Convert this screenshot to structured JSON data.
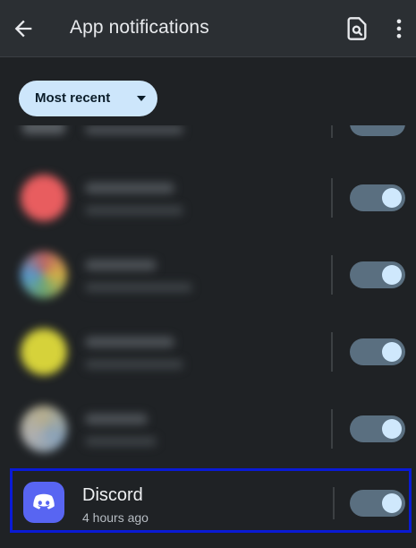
{
  "header": {
    "title": "App notifications",
    "icons": {
      "back": "arrow-back-icon",
      "search": "search-document-icon",
      "more": "more-vert-icon"
    }
  },
  "filter": {
    "selected": "Most recent",
    "icon": "caret-down-icon"
  },
  "apps": [
    {
      "name": "",
      "time": "",
      "icon_color": "#e85d5f",
      "enabled": true
    },
    {
      "name": "",
      "time": "",
      "icon_color": "#c9c9c9",
      "enabled": true
    },
    {
      "name": "",
      "time": "",
      "icon_color": "#d6d23a",
      "enabled": true
    },
    {
      "name": "",
      "time": "",
      "icon_color": "#c7c5b8",
      "enabled": true
    }
  ],
  "highlighted_app": {
    "name": "Discord",
    "time": "4 hours ago",
    "icon": "discord-icon",
    "icon_color": "#5865f2",
    "enabled": true,
    "highlight_color": "#0a1ad6"
  },
  "colors": {
    "background": "#1f2225",
    "toggle_track": "#5a6f80",
    "toggle_knob": "#cfe8fc",
    "chip": "#cde6fb"
  }
}
